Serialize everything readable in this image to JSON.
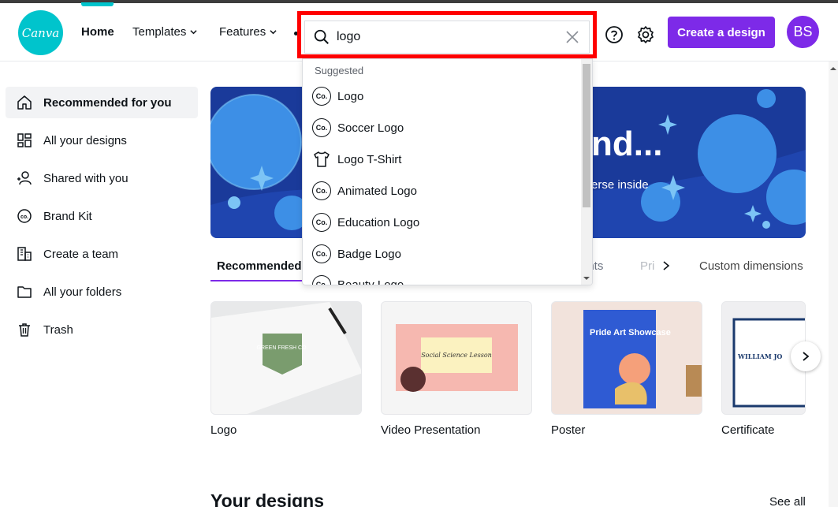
{
  "header": {
    "logo_text": "Canva",
    "nav_home": "Home",
    "nav_templates": "Templates",
    "nav_features": "Features",
    "search_value": "logo",
    "create_button": "Create a design",
    "avatar_initials": "BS"
  },
  "sidebar": {
    "items": [
      {
        "label": "Recommended for you",
        "icon": "home-icon",
        "active": true
      },
      {
        "label": "All your designs",
        "icon": "grid-icon"
      },
      {
        "label": "Shared with you",
        "icon": "shared-users-icon"
      },
      {
        "label": "Brand Kit",
        "icon": "brand-kit-icon"
      },
      {
        "label": "Create a team",
        "icon": "team-building-icon"
      },
      {
        "label": "All your folders",
        "icon": "folder-icon"
      },
      {
        "label": "Trash",
        "icon": "trash-icon"
      }
    ]
  },
  "hero": {
    "title": "nd...",
    "subtitle": "erse inside"
  },
  "tabs": {
    "recommended": "Recommended",
    "events": "ents",
    "print": "Pri",
    "custom": "Custom dimensions"
  },
  "dropdown": {
    "heading": "Suggested",
    "coin_text": "Co.",
    "items": [
      {
        "label": "Logo",
        "icon": "canva-coin-icon"
      },
      {
        "label": "Soccer Logo",
        "icon": "canva-coin-icon"
      },
      {
        "label": "Logo T-Shirt",
        "icon": "tshirt-icon"
      },
      {
        "label": "Animated Logo",
        "icon": "canva-coin-icon"
      },
      {
        "label": "Education Logo",
        "icon": "canva-coin-icon"
      },
      {
        "label": "Badge Logo",
        "icon": "canva-coin-icon"
      },
      {
        "label": "Beauty Logo",
        "icon": "canva-coin-icon"
      }
    ]
  },
  "cards": [
    {
      "label": "Logo",
      "thumb_text": "GREEN FRESH CO."
    },
    {
      "label": "Video Presentation",
      "thumb_text": "Social Science Lesson"
    },
    {
      "label": "Poster",
      "thumb_text": "Pride Art Showcase"
    },
    {
      "label": "Certificate",
      "thumb_text": "WILLIAM JO"
    }
  ],
  "section": {
    "your_designs": "Your designs",
    "see_all": "See all"
  },
  "colors": {
    "brand_purple": "#7d2ae8",
    "canva_teal": "#00c4cc",
    "highlight_red": "#ff0000",
    "hero_blue": "#1a3a9a"
  }
}
